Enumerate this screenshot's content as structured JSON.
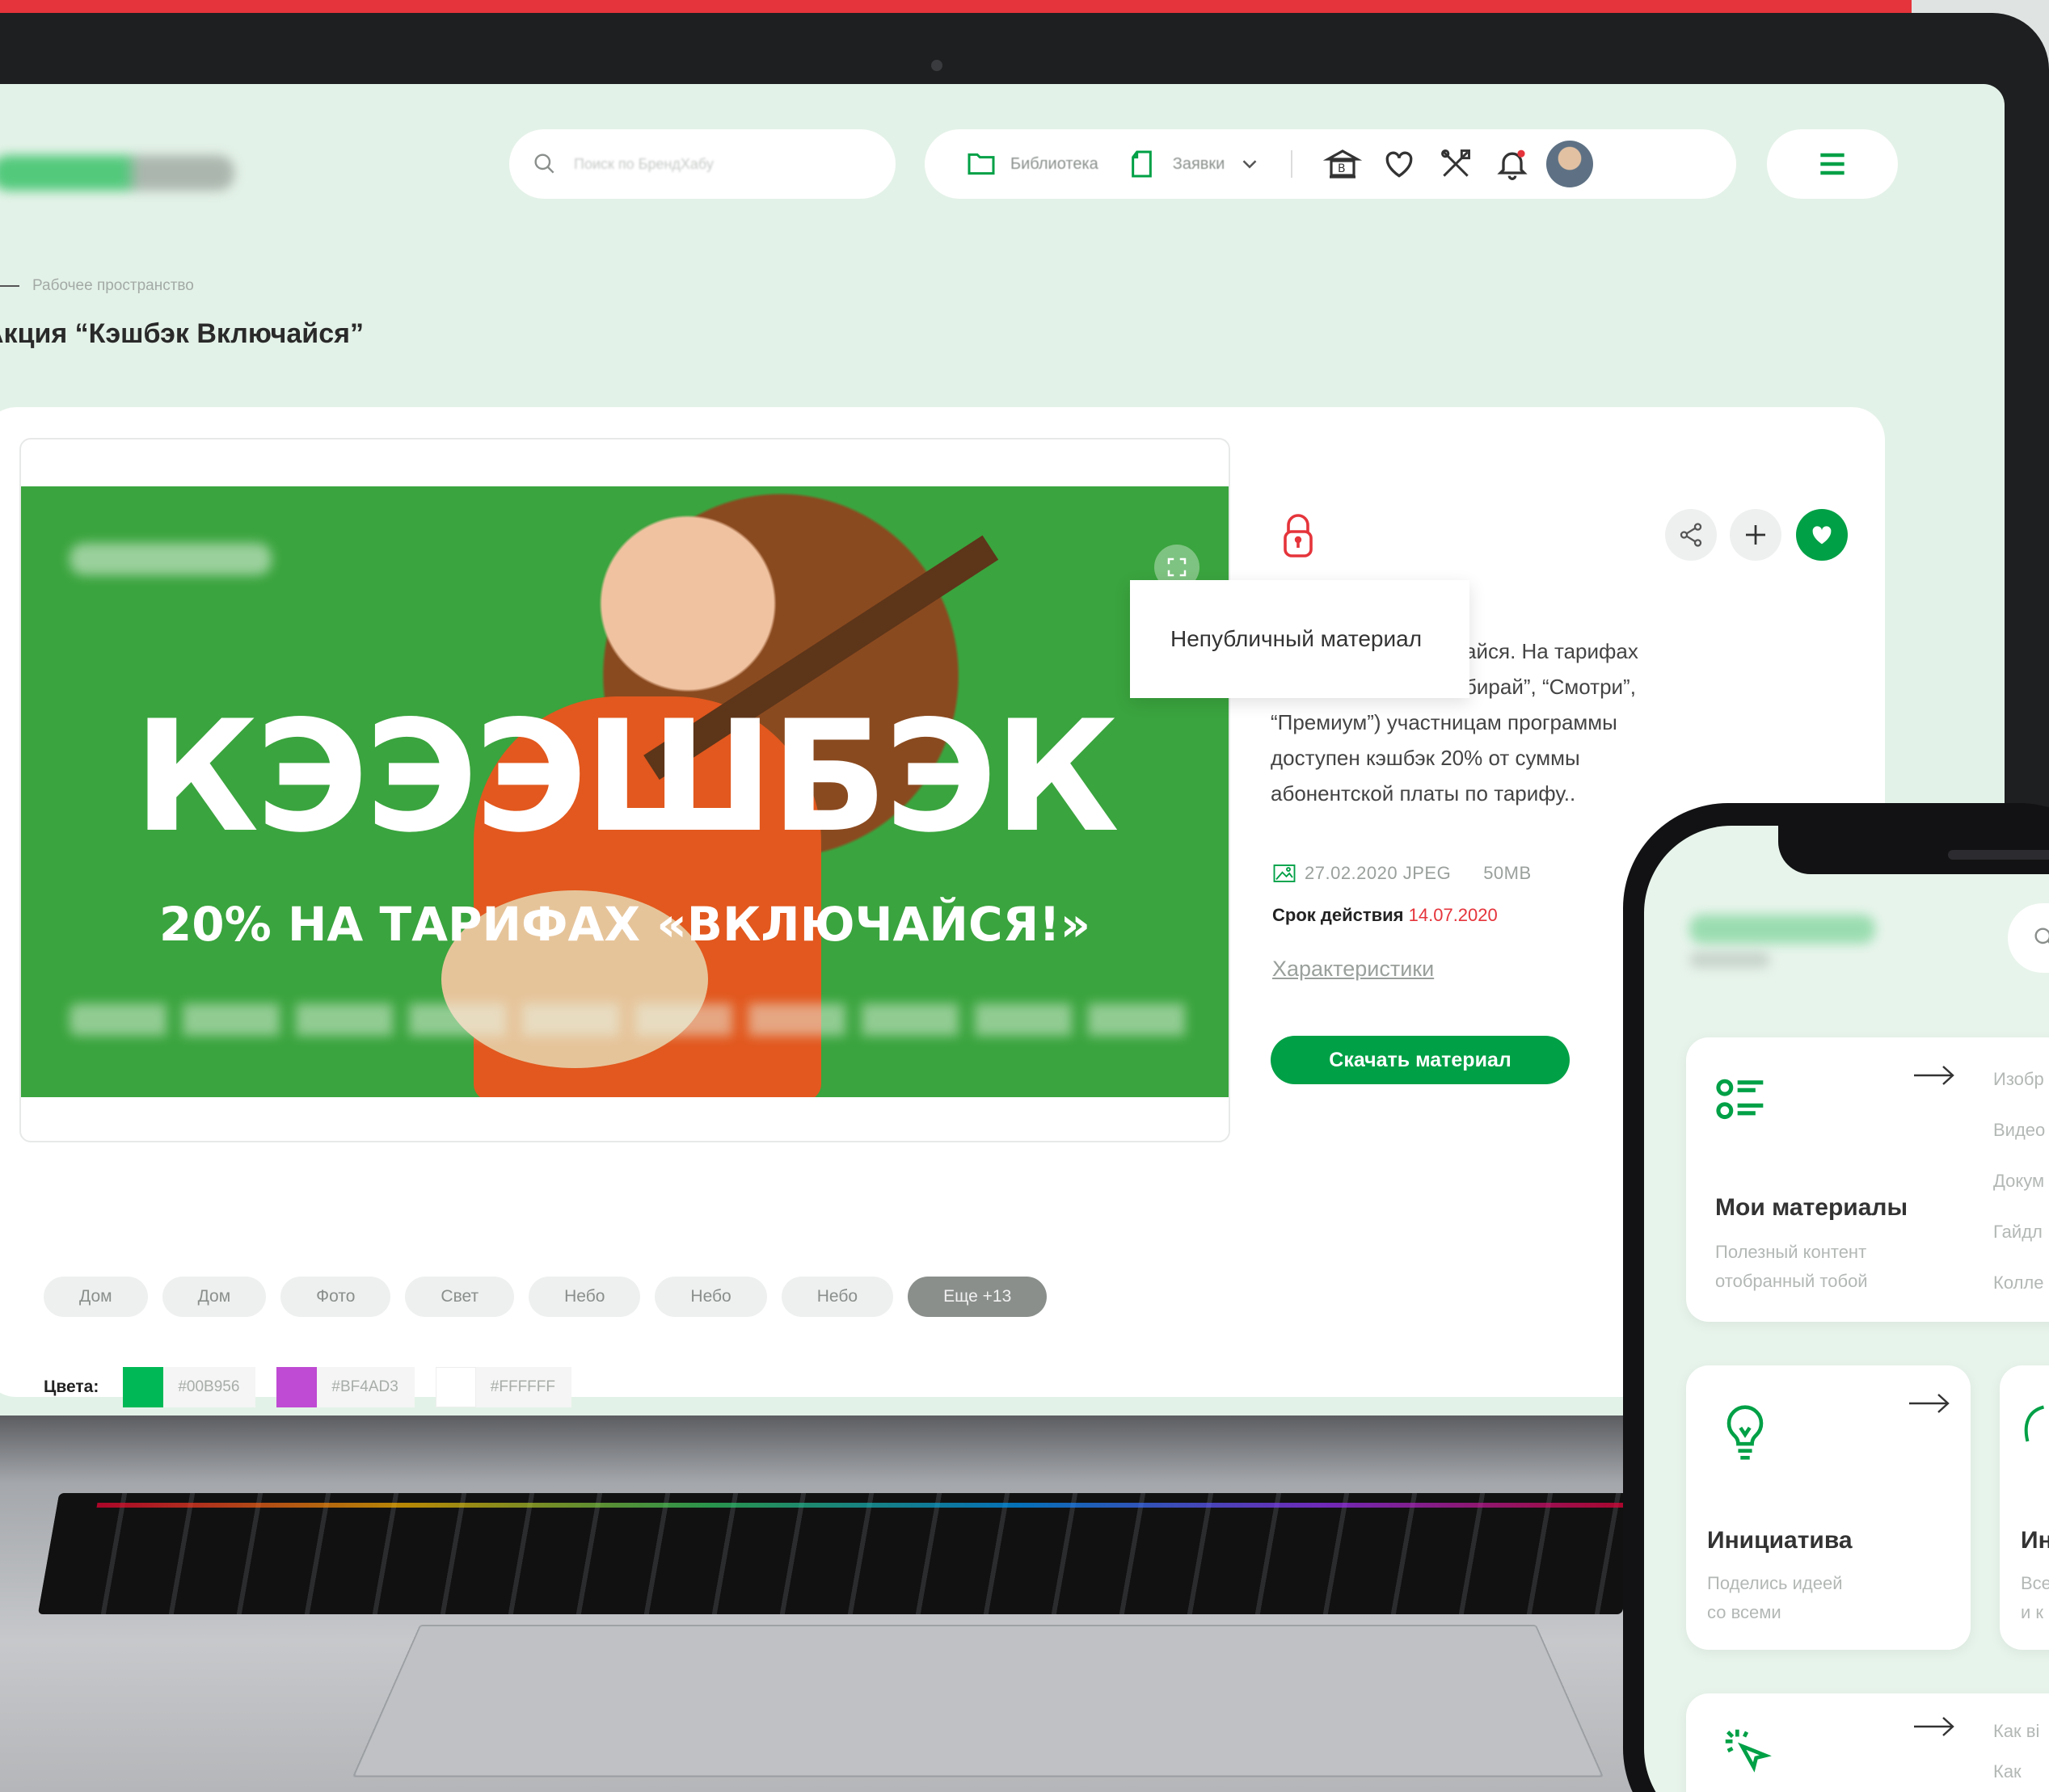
{
  "colors": {
    "brand_green": "#00A046",
    "accent_red": "#E5343B",
    "screen_bg": "#E3F2E8"
  },
  "header": {
    "search_placeholder": "Поиск по БрендХабу",
    "nav": {
      "library": "Библиотека",
      "requests": "Заявки"
    },
    "icons": [
      "folder-icon",
      "document-icon",
      "chevron-down-icon",
      "museum-icon",
      "heart-icon",
      "tools-icon",
      "bell-icon",
      "avatar",
      "menu-icon"
    ]
  },
  "breadcrumb": {
    "label": "Рабочее пространство"
  },
  "page": {
    "title": "Акция “Кэшбэк Включайся”"
  },
  "material": {
    "banner": {
      "headline": "КЭЭЭШБЭК",
      "subline": "20% НА ТАРИФАХ «ВКЛЮЧАЙСЯ!»"
    },
    "tooltip": "Непубличный материал",
    "description_lines": [
      "айся. На тарифах",
      "бирай”, “Смотри”,",
      "“Премиум”) участницам программы",
      "доступен кэшбэк 20% от суммы",
      "абонентской платы по тарифу.."
    ],
    "meta": {
      "date_format": "27.02.2020 JPEG",
      "size": "50MB"
    },
    "validity_label": "Срок действия",
    "validity_date": "14.07.2020",
    "characteristics_link": "Характеристики",
    "download_button": "Скачать материал",
    "tags": [
      "Дом",
      "Дом",
      "Фото",
      "Свет",
      "Небо",
      "Небо",
      "Небо"
    ],
    "more_tags": "Еще +13",
    "colors_label": "Цвета:",
    "swatches": [
      {
        "hex": "#00B956",
        "label": "#00B956"
      },
      {
        "hex": "#BF4AD3",
        "label": "#BF4AD3"
      },
      {
        "hex": "#FFFFFF",
        "label": "#FFFFFF"
      }
    ]
  },
  "phone": {
    "cards": [
      {
        "title": "Мои материалы",
        "sub1": "Полезный контент",
        "sub2": "отобранный тобой"
      },
      {
        "title": "Инициатива",
        "sub1": "Поделись идеей",
        "sub2": "со всеми"
      },
      {
        "title": "Ин",
        "sub1": "Все",
        "sub2": "и к"
      }
    ],
    "side_list": [
      "Изобр",
      "Видео",
      "Докум",
      "Гайдл",
      "Колле"
    ],
    "bottom_list": [
      "Как ві",
      "Как"
    ]
  }
}
